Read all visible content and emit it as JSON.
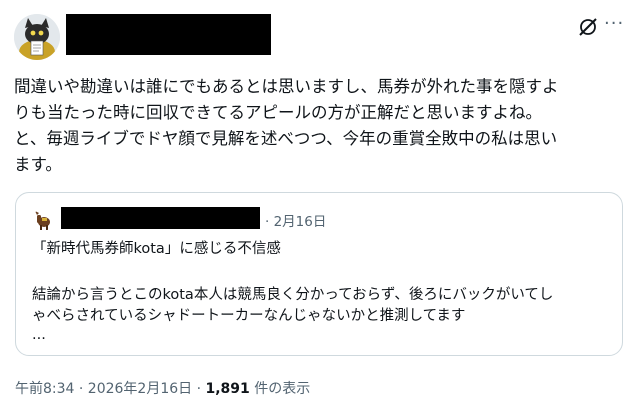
{
  "tweet": {
    "body_lines": [
      "間違いや勘違いは誰にでもあるとは思いますし、馬券が外れた事を隠すよ",
      "りも当たった時に回収できてるアピールの方が正解だと思いますよね。",
      "と、毎週ライブでドヤ顔で見解を述べつつ、今年の重賞全敗中の私は思い",
      "ます。"
    ],
    "timestamp": "午前8:34 · 2026年2月16日",
    "view_separator": " · ",
    "view_count": "1,891",
    "view_label": " 件の表示"
  },
  "quote": {
    "date": "· 2月16日",
    "title": "「新時代馬券師kota」に感じる不信感",
    "lines": [
      "結論から言うとこのkota本人は競馬良く分かっておらず、後ろにバックがいてし",
      "ゃべらされているシャドートーカーなんじゃないかと推測してます",
      "..."
    ]
  },
  "icons": {
    "grok": "grok-icon",
    "more": "more-icon",
    "more_glyph": "···"
  },
  "colors": {
    "text": "#0f1419",
    "secondary": "#536471",
    "border": "#cfd9de",
    "redaction": "#000000"
  }
}
